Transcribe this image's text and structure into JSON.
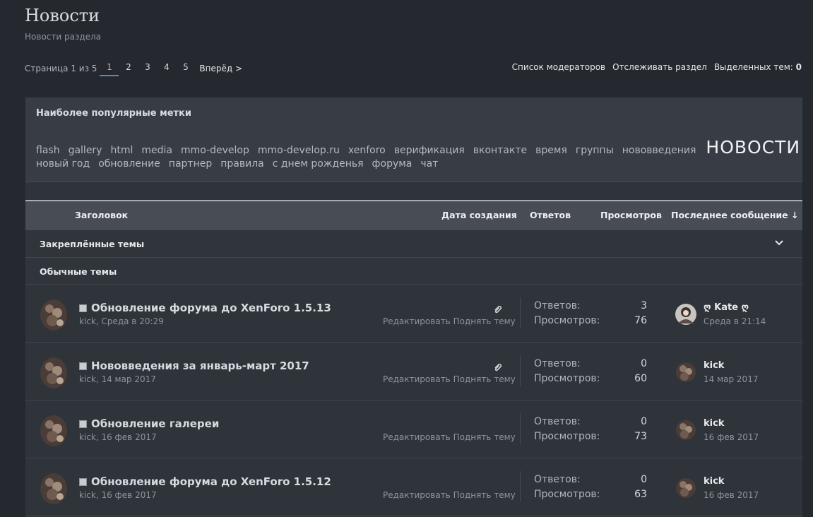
{
  "header": {
    "title": "Новости",
    "subtitle": "Новости раздела"
  },
  "pagination": {
    "label": "Страница 1 из 5",
    "pages": [
      "1",
      "2",
      "3",
      "4",
      "5"
    ],
    "current": "1",
    "next_label": "Вперёд >"
  },
  "top_links": {
    "moderators": "Список модераторов",
    "watch": "Отслеживать раздел",
    "selected_label": "Выделенных тем:",
    "selected_count": "0"
  },
  "tags": {
    "title": "Наиболее популярные метки",
    "line1": [
      "flash",
      "gallery",
      "html",
      "media",
      "mmo-develop",
      "mmo-develop.ru",
      "xenforo",
      "верификация",
      "вконтакте",
      "время",
      "группы",
      "нововведения"
    ],
    "big_tag": "НОВОСТИ",
    "line2": [
      "новый год",
      "обновление",
      "партнер",
      "правила",
      "с днем рожденья",
      "форума",
      "чат"
    ]
  },
  "columns": {
    "title": "Заголовок",
    "created": "Дата создания",
    "replies": "Ответов",
    "views": "Просмотров",
    "last": "Последнее сообщение ↓"
  },
  "groups": {
    "pinned": "Закреплённые темы",
    "normal": "Обычные темы"
  },
  "thread_labels": {
    "replies": "Ответов:",
    "views": "Просмотров:",
    "edit": "Редактировать",
    "bump": "Поднять тему"
  },
  "threads": [
    {
      "title": "Обновление форума до XenForo 1.5.13",
      "meta": "kick, Среда в 20:29",
      "attachment": true,
      "replies": "3",
      "views": "76",
      "last_user": "Kate",
      "last_date": "Среда в 21:14"
    },
    {
      "title": "Нововведения за январь-март 2017",
      "meta": "kick, 14 мар 2017",
      "attachment": true,
      "replies": "0",
      "views": "60",
      "last_user": "kick",
      "last_date": "14 мар 2017"
    },
    {
      "title": "Обновление галереи",
      "meta": "kick, 16 фев 2017",
      "attachment": false,
      "replies": "0",
      "views": "73",
      "last_user": "kick",
      "last_date": "16 фев 2017"
    },
    {
      "title": "Обновление форума до XenForo 1.5.12",
      "meta": "kick, 16 фев 2017",
      "attachment": false,
      "replies": "0",
      "views": "63",
      "last_user": "kick",
      "last_date": "16 фев 2017"
    }
  ],
  "icons": {
    "user_decor_left": "ღ",
    "user_decor_right": "ღ"
  }
}
